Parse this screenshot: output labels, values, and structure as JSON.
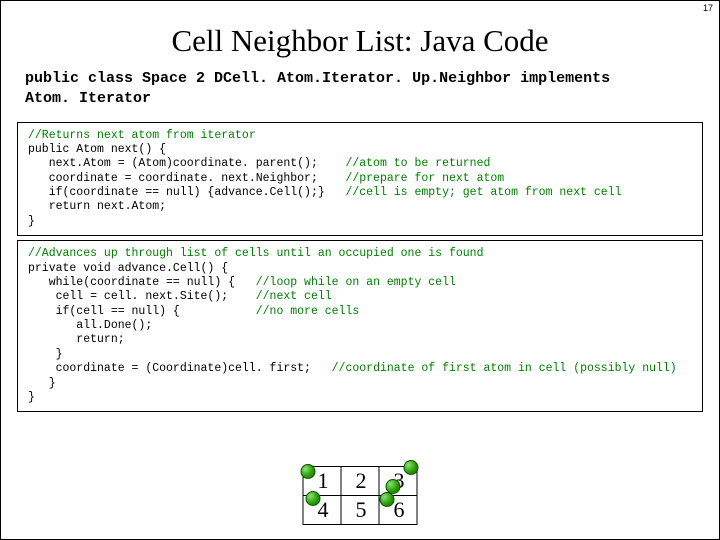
{
  "page_number": "17",
  "title": "Cell Neighbor List: Java Code",
  "class_decl_line1": "public class Space 2 DCell. Atom.Iterator. Up.Neighbor implements",
  "class_decl_line2": "Atom. Iterator",
  "code_block1": {
    "l1": "//Returns next atom from iterator",
    "l2": "public Atom next() {",
    "l3a": "   next.Atom = (Atom)coordinate. parent();    ",
    "l3c": "//atom to be returned",
    "l4a": "   coordinate = coordinate. next.Neighbor;    ",
    "l4c": "//prepare for next atom",
    "l5a": "   if(coordinate == null) {advance.Cell();}   ",
    "l5c": "//cell is empty; get atom from next cell",
    "l6": "   return next.Atom;",
    "l7": "}"
  },
  "code_block2": {
    "l1": "//Advances up through list of cells until an occupied one is found",
    "l2": "private void advance.Cell() {",
    "l3a": "   while(coordinate == null) {   ",
    "l3c": "//loop while on an empty cell",
    "l4a": "    cell = cell. next.Site();    ",
    "l4c": "//next cell",
    "l5a": "    if(cell == null) {           ",
    "l5c": "//no more cells",
    "l6": "       all.Done();",
    "l7": "       return;",
    "l8": "    }",
    "l9a": "    coordinate = (Coordinate)cell. first;   ",
    "l9c": "//coordinate of first atom in cell (possibly null)",
    "l10": "   }",
    "l11": "}"
  },
  "grid": {
    "cells": [
      "1",
      "2",
      "3",
      "4",
      "5",
      "6"
    ]
  }
}
